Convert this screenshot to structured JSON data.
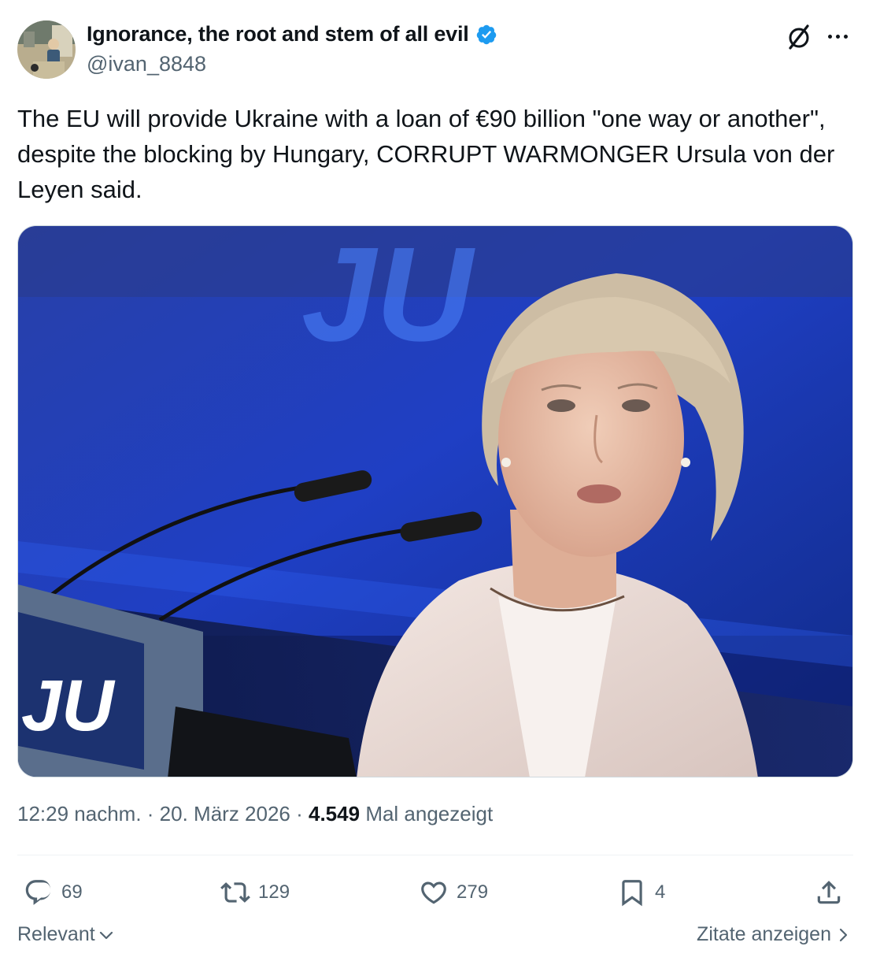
{
  "author": {
    "display_name": "Ignorance, the root and stem of all evil",
    "handle": "@ivan_8848",
    "verified": true
  },
  "tweet": {
    "text": "The EU will provide Ukraine with a loan of €90 billion \"one way or another\", despite the blocking by Hungary, CORRUPT WARMONGER Ursula von der Leyen said.",
    "time": "12:29 nachm.",
    "separator": " · ",
    "date": "20. März 2026",
    "views": "4.549",
    "views_label": "Mal angezeigt"
  },
  "media": {
    "backdrop_text": "JU",
    "lectern_text": "JU"
  },
  "actions": {
    "replies": "69",
    "reposts": "129",
    "likes": "279",
    "bookmarks": "4"
  },
  "footer": {
    "sort_label": "Relevant",
    "quotes_label": "Zitate anzeigen"
  },
  "colors": {
    "text": "#0f1419",
    "secondary": "#536471",
    "verified_blue": "#1d9bf0",
    "divider": "#eff3f4"
  },
  "icons": [
    "grok-icon",
    "more-icon",
    "verified-badge-icon",
    "reply-icon",
    "repost-icon",
    "like-icon",
    "bookmark-icon",
    "share-icon",
    "chevron-down-icon",
    "chevron-right-icon"
  ]
}
